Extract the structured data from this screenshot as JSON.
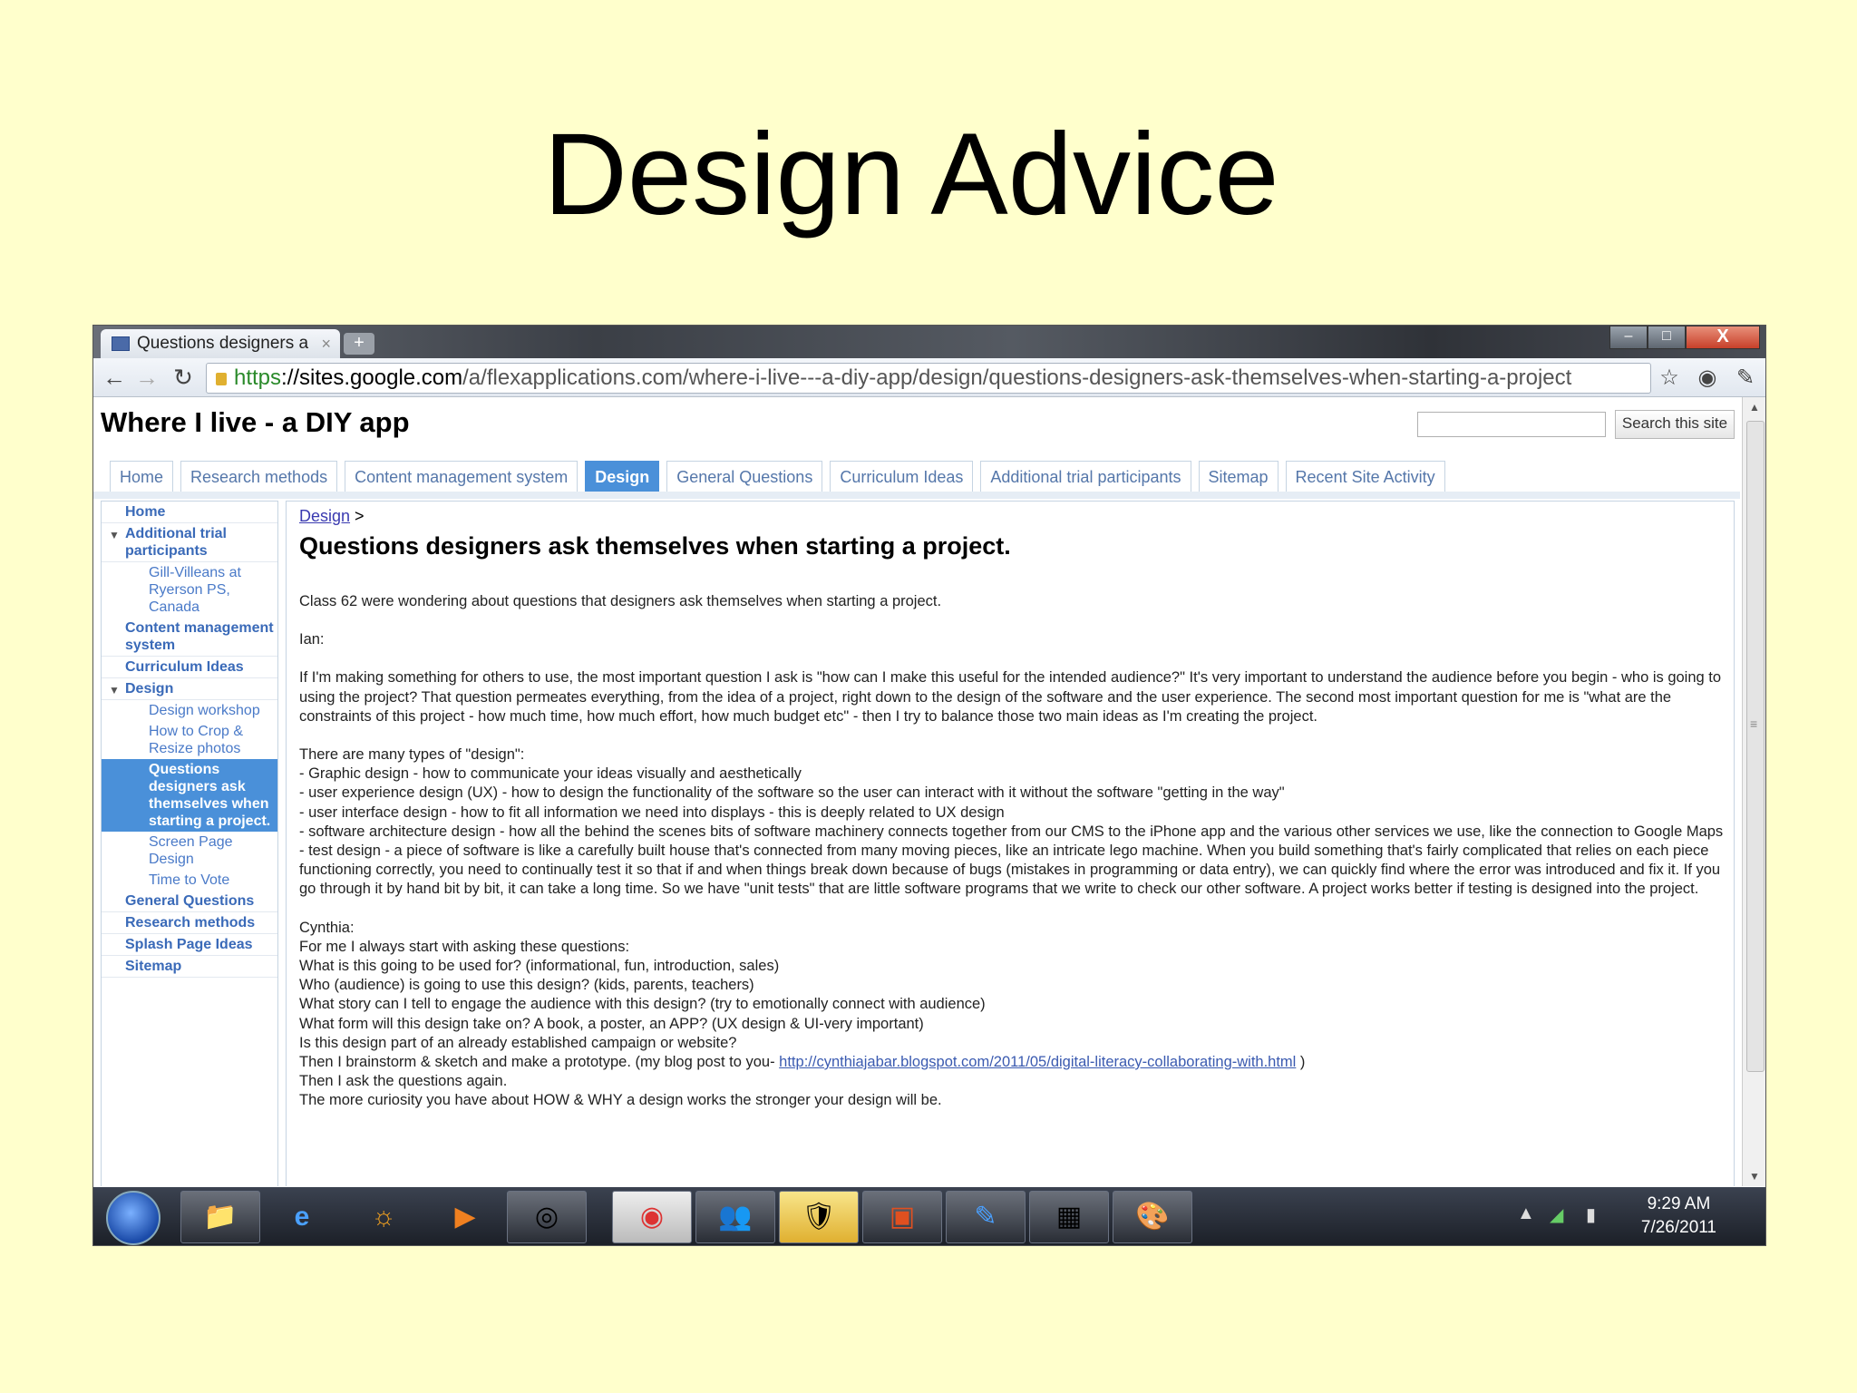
{
  "slide": {
    "title": "Design Advice"
  },
  "browser": {
    "tab_title": "Questions designers a",
    "tab_close": "×",
    "new_tab": "+",
    "url_scheme": "https",
    "url_host": "://sites.google.com",
    "url_path": "/a/flexapplications.com/where-i-live---a-diy-app/design/questions-designers-ask-themselves-when-starting-a-project",
    "window_buttons": {
      "minimize": "–",
      "maximize": "□",
      "close": "X"
    }
  },
  "site": {
    "title": "Where I live - a DIY app",
    "search_button": "Search this site",
    "nav_tabs": [
      "Home",
      "Research methods",
      "Content management system",
      "Design",
      "General Questions",
      "Curriculum Ideas",
      "Additional trial participants",
      "Sitemap",
      "Recent Site Activity"
    ],
    "active_tab": "Design"
  },
  "sidebar": {
    "home": "Home",
    "additional": "Additional trial participants",
    "additional_sub": "Gill-Villeans at Ryerson PS, Canada",
    "cms": "Content management system",
    "curriculum": "Curriculum Ideas",
    "design": "Design",
    "design_sub": [
      "Design workshop",
      "How to Crop & Resize photos",
      "Questions designers ask themselves when starting a project.",
      "Screen Page Design",
      "Time to Vote"
    ],
    "general": "General Questions",
    "research": "Research methods",
    "splash": "Splash Page Ideas",
    "sitemap": "Sitemap"
  },
  "content": {
    "breadcrumb_link": "Design",
    "breadcrumb_sep": " >",
    "heading": "Questions designers ask themselves when starting a project.",
    "p1": "Class 62 were wondering about questions that designers ask themselves when starting a project.",
    "p2": "Ian:",
    "p3": "If I'm making something for others to use, the most important question I ask is \"how can I make this useful for the intended audience?\" It's very important to understand the audience before you begin - who is going to using the project? That question permeates everything, from the idea of a project, right down to the design of the software and the user experience. The second most important question for me is \"what are the constraints of this project - how much time, how much effort, how much budget etc\" - then I try to balance those two main ideas as I'm creating the project.",
    "p4": "There are many types of \"design\":\n- Graphic design - how to communicate your ideas visually and aesthetically\n- user experience design (UX) - how to design the functionality of the software so the user can interact with it without the software \"getting in the way\"\n- user interface design - how to fit all information we need into displays - this is deeply related to UX design\n- software architecture design - how all the behind the scenes bits of software machinery connects together from our CMS to the iPhone app and the various other services we use, like the connection to Google Maps\n- test design - a piece of software is like a carefully built house that's connected from many moving pieces, like an intricate lego machine. When you build something that's fairly complicated that relies on each piece functioning correctly, you need to continually test it so that if and when things break down because of bugs (mistakes in programming or data entry), we can quickly find where the error was introduced and fix it. If you go through it by hand bit by bit, it can take a long time. So we have \"unit tests\" that are little software programs that we write to check our other software. A project works better if testing is designed into the project.",
    "p5": "Cynthia:\nFor me I always start with asking these questions:\nWhat is this going to be used for? (informational, fun, introduction, sales)\nWho (audience) is going to use this design? (kids, parents, teachers)\nWhat story can I tell to engage the audience with this design? (try to emotionally connect with audience)\nWhat form will this design take on? A book, a poster, an APP? (UX design & UI-very important)\nIs this design part of an already established campaign or website?",
    "p6_before": "Then I brainstorm & sketch and make a prototype. (my blog post to you- ",
    "p6_link": "http://cynthiajabar.blogspot.com/2011/05/digital-literacy-collaborating-with.html",
    "p6_after": " )",
    "p7": "Then I ask the questions again.\nThe more curiosity you have about HOW & WHY a design works the stronger your design will be."
  },
  "taskbar": {
    "time": "9:29 AM",
    "date": "7/26/2011"
  }
}
